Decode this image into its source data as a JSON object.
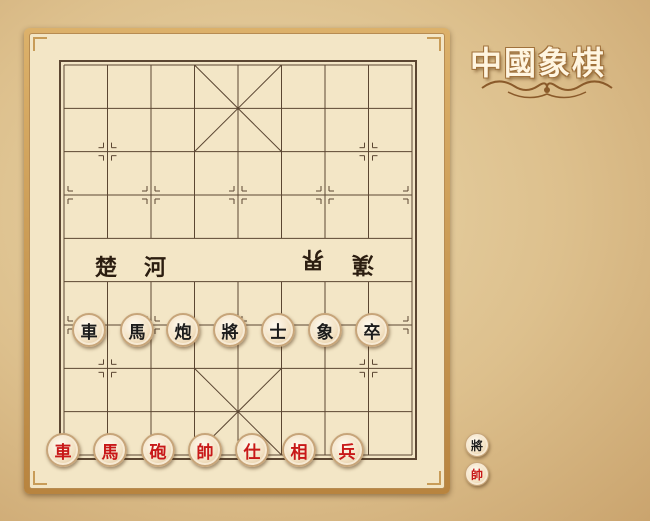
{
  "title": "中國象棋",
  "river": {
    "left_1": "楚",
    "left_2": "河",
    "right_1": "界",
    "right_2": "漢"
  },
  "black_pieces": [
    "車",
    "馬",
    "炮",
    "將",
    "士",
    "象",
    "卒"
  ],
  "red_pieces": [
    "車",
    "馬",
    "砲",
    "帥",
    "仕",
    "相",
    "兵"
  ],
  "side_indicators": {
    "black": "將",
    "red": "帥"
  },
  "colors": {
    "red_piece": "#c81818",
    "black_piece": "#1c1c1c",
    "board": "#f3e6c6",
    "line": "#5b4632"
  }
}
